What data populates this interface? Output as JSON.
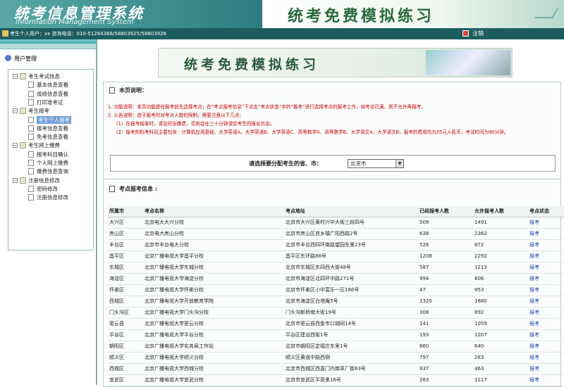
{
  "header": {
    "system_title": "统考信息管理系统",
    "system_subtitle": "Information Management System",
    "banner_title": "统考免费模拟练习"
  },
  "topbar": {
    "user_text": "考生个人用户：xx 咨询电话：010-51284366/58803925/58803926",
    "logout": "注销"
  },
  "sidebar": {
    "title": "用户管理",
    "tree": [
      {
        "label": "考生考试信息",
        "level": 0,
        "expander": "−"
      },
      {
        "label": "基本信息查看",
        "level": 1
      },
      {
        "label": "成绩信息查看",
        "level": 1
      },
      {
        "label": "打印准考证",
        "level": 1
      },
      {
        "label": "考生报考",
        "level": 0,
        "expander": "−"
      },
      {
        "label": "考生个人报考",
        "level": 1,
        "selected": true
      },
      {
        "label": "报考信息查看",
        "level": 1
      },
      {
        "label": "免考信息查看",
        "level": 1
      },
      {
        "label": "考生网上缴费",
        "level": 0,
        "expander": "−"
      },
      {
        "label": "报考科目确认",
        "level": 1
      },
      {
        "label": "个人网上缴费",
        "level": 1
      },
      {
        "label": "缴费信息查询",
        "level": 1
      },
      {
        "label": "注册信息修改",
        "level": 0,
        "expander": "−"
      },
      {
        "label": "密码修改",
        "level": 1
      },
      {
        "label": "注册信息修改",
        "level": 1
      }
    ]
  },
  "main": {
    "promo_title": "统考免费模拟练习",
    "desc_title": "本页说明：",
    "desc_lines": [
      "1. 功能说明：本页功能是在报考前先选择考点，在“考点报考信息”下点击“考点状态”中的“报考”进行选择考点的报考工作，如考点已满，则不允许再报考。",
      "2. 公告说明：由于报考时对考点人数的限制，需要注意以下几点：",
      "（1）在报考结束时，请及时去缴费，否则会在三十分钟请空考生的报名信息。",
      "（2）报考的机考科目主要包含：计算机应用基础、大学英语A、大学英语B、大学英语C、高等数学A、高等数学B、大学语文A、大学语文B，报考的费用均为35元人民币；考试时间为90分钟。"
    ],
    "region_label": "请选择要分配考生的省、市:",
    "region_value": "北京市",
    "info_title": "考点报考信息 :",
    "table": {
      "columns": [
        "所属市",
        "考点名称",
        "考点地址",
        "已经报考人数",
        "允许报考人数",
        "考点状态"
      ],
      "rows": [
        [
          "大兴区",
          "北京电大大兴分校",
          "北京市大兴区黄村兴华大街三段四号",
          "509",
          "1491",
          "报考"
        ],
        [
          "房山区",
          "北京电大房山分校",
          "北京市房山区良乡镇广阳西路2号",
          "638",
          "2362",
          "报考"
        ],
        [
          "丰台区",
          "北京市丰台电大分校",
          "北京市丰台西四环南路望园东里23号",
          "528",
          "872",
          "报考"
        ],
        [
          "昌平区",
          "北京广播电视大学昌平分校",
          "昌平区东环路88号",
          "1208",
          "2292",
          "报考"
        ],
        [
          "东城区",
          "北京广播电视大学东城分校",
          "北京市东城区东四西大街48号",
          "587",
          "1213",
          "报考"
        ],
        [
          "海淀区",
          "北京广播电视大学海淀分校",
          "北京市海淀区北四环中路271号",
          "994",
          "806",
          "报考"
        ],
        [
          "怀柔区",
          "北京广播电视大学怀柔分校",
          "北京市怀柔区小中富乐一区188号",
          "47",
          "953",
          "报考"
        ],
        [
          "西城区",
          "北京广播电视大学开放教育学院",
          "北京市海淀区白塔庵5号",
          "1320",
          "1680",
          "报考"
        ],
        [
          "门头沟区",
          "北京广播电视大学门头沟分校",
          "门头沟新桥南大街19号",
          "308",
          "892",
          "报考"
        ],
        [
          "密云县",
          "北京广播电视大学密云分校",
          "北京市密云县西鱼市口胡同14号",
          "141",
          "1059",
          "报考"
        ],
        [
          "平谷区",
          "北京广播电视大学平谷分校",
          "平谷区建设西街1号",
          "193",
          "1207",
          "报考"
        ],
        [
          "朝阳区",
          "北京广播电视大学实务局工作站",
          "北京市朝阳区定福庄东里1号",
          "860",
          "640",
          "报考"
        ],
        [
          "顺义区",
          "北京广播电视大学顺义分校",
          "顺义区黄道中路西侧",
          "797",
          "283",
          "报考"
        ],
        [
          "西城区",
          "北京广播电视大学西城分校",
          "北京市西城区西直门内南草厂街63号",
          "937",
          "463",
          "报考"
        ],
        [
          "宣武区",
          "北京广播电视大学宣武分校",
          "北京市宣武区平原里16号",
          "283",
          "1117",
          "报考"
        ]
      ]
    }
  }
}
